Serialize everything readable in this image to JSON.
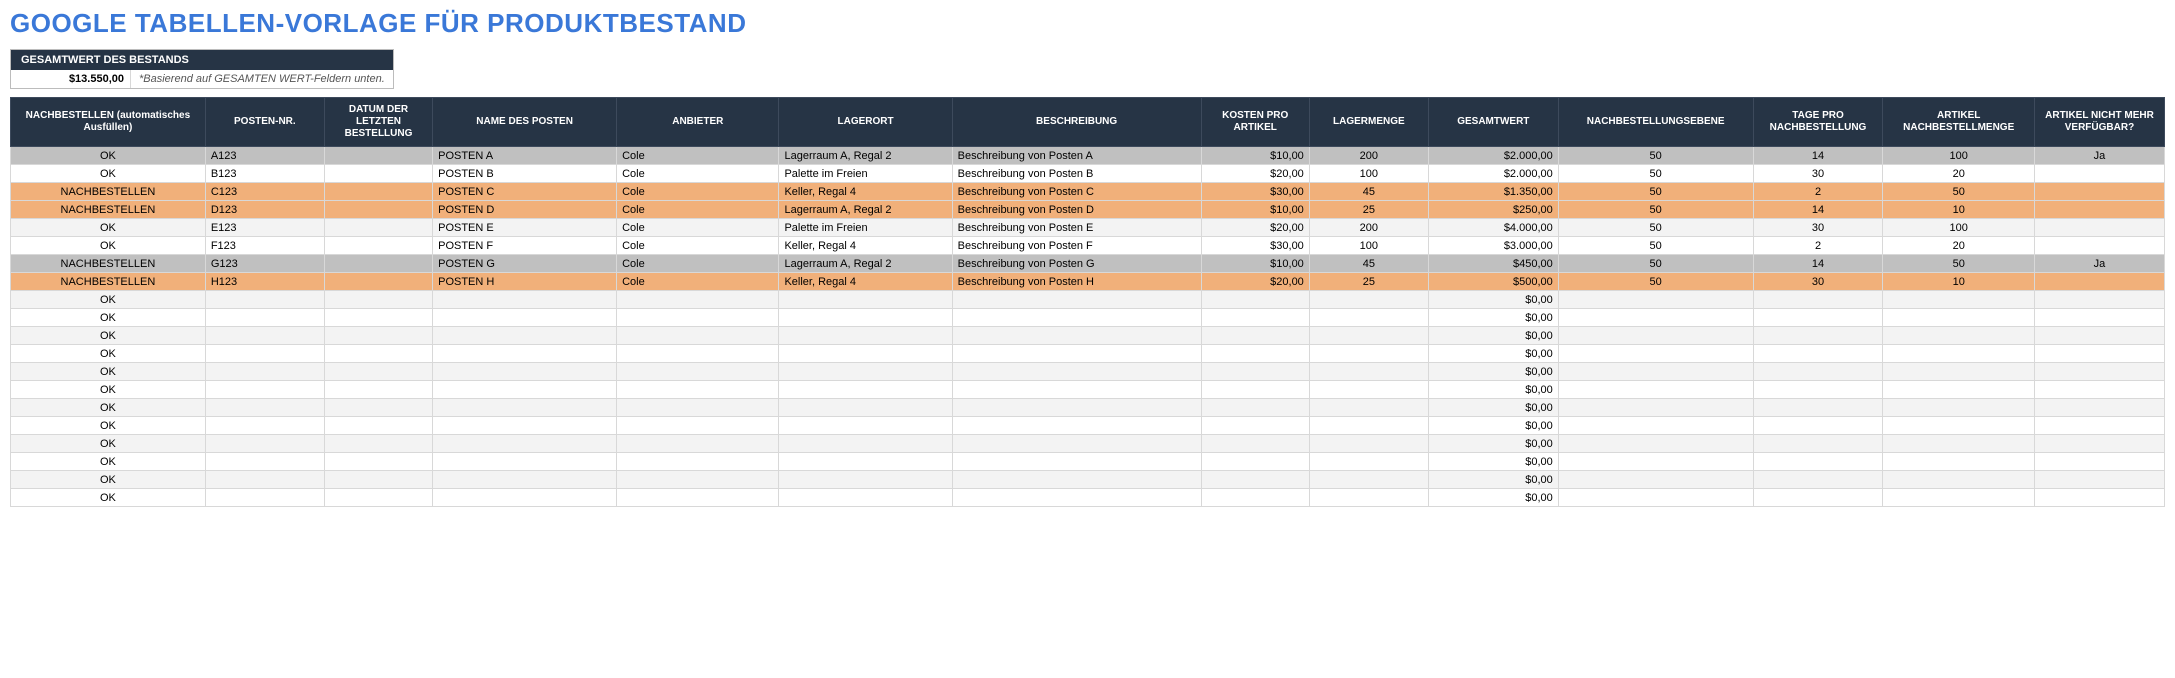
{
  "title": "GOOGLE TABELLEN-VORLAGE FÜR PRODUKTBESTAND",
  "summary": {
    "label": "GESAMTWERT DES BESTANDS",
    "value": "$13.550,00",
    "note": "*Basierend auf GESAMTEN WERT-Feldern unten."
  },
  "columns": [
    "NACHBESTELLEN (automatisches Ausfüllen)",
    "POSTEN-NR.",
    "DATUM DER LETZTEN BESTELLUNG",
    "NAME DES POSTEN",
    "ANBIETER",
    "LAGERORT",
    "BESCHREIBUNG",
    "KOSTEN PRO ARTIKEL",
    "LAGERMENGE",
    "GESAMTWERT",
    "NACHBESTELLUNGSEBENE",
    "TAGE PRO NACHBESTELLUNG",
    "ARTIKEL NACHBESTELLMENGE",
    "ARTIKEL NICHT MEHR VERFÜGBAR?"
  ],
  "rows": [
    {
      "style": "grey",
      "reorder": "OK",
      "item": "A123",
      "date": "",
      "name": "POSTEN A",
      "vendor": "Cole",
      "loc": "Lagerraum A, Regal 2",
      "desc": "Beschreibung von Posten A",
      "cost": "$10,00",
      "qty": "200",
      "total": "$2.000,00",
      "level": "50",
      "days": "14",
      "reqty": "100",
      "disc": "Ja"
    },
    {
      "style": "odd",
      "reorder": "OK",
      "item": "B123",
      "date": "",
      "name": "POSTEN B",
      "vendor": "Cole",
      "loc": "Palette im Freien",
      "desc": "Beschreibung von Posten B",
      "cost": "$20,00",
      "qty": "100",
      "total": "$2.000,00",
      "level": "50",
      "days": "30",
      "reqty": "20",
      "disc": ""
    },
    {
      "style": "orange",
      "reorder": "NACHBESTELLEN",
      "item": "C123",
      "date": "",
      "name": "POSTEN C",
      "vendor": "Cole",
      "loc": "Keller, Regal 4",
      "desc": "Beschreibung von Posten C",
      "cost": "$30,00",
      "qty": "45",
      "total": "$1.350,00",
      "level": "50",
      "days": "2",
      "reqty": "50",
      "disc": ""
    },
    {
      "style": "orange",
      "reorder": "NACHBESTELLEN",
      "item": "D123",
      "date": "",
      "name": "POSTEN D",
      "vendor": "Cole",
      "loc": "Lagerraum A, Regal 2",
      "desc": "Beschreibung von Posten D",
      "cost": "$10,00",
      "qty": "25",
      "total": "$250,00",
      "level": "50",
      "days": "14",
      "reqty": "10",
      "disc": ""
    },
    {
      "style": "even",
      "reorder": "OK",
      "item": "E123",
      "date": "",
      "name": "POSTEN E",
      "vendor": "Cole",
      "loc": "Palette im Freien",
      "desc": "Beschreibung von Posten E",
      "cost": "$20,00",
      "qty": "200",
      "total": "$4.000,00",
      "level": "50",
      "days": "30",
      "reqty": "100",
      "disc": ""
    },
    {
      "style": "odd",
      "reorder": "OK",
      "item": "F123",
      "date": "",
      "name": "POSTEN F",
      "vendor": "Cole",
      "loc": "Keller, Regal 4",
      "desc": "Beschreibung von Posten F",
      "cost": "$30,00",
      "qty": "100",
      "total": "$3.000,00",
      "level": "50",
      "days": "2",
      "reqty": "20",
      "disc": ""
    },
    {
      "style": "grey",
      "reorder": "NACHBESTELLEN",
      "item": "G123",
      "date": "",
      "name": "POSTEN G",
      "vendor": "Cole",
      "loc": "Lagerraum A, Regal 2",
      "desc": "Beschreibung von Posten G",
      "cost": "$10,00",
      "qty": "45",
      "total": "$450,00",
      "level": "50",
      "days": "14",
      "reqty": "50",
      "disc": "Ja"
    },
    {
      "style": "orange",
      "reorder": "NACHBESTELLEN",
      "item": "H123",
      "date": "",
      "name": "POSTEN H",
      "vendor": "Cole",
      "loc": "Keller, Regal 4",
      "desc": "Beschreibung von Posten H",
      "cost": "$20,00",
      "qty": "25",
      "total": "$500,00",
      "level": "50",
      "days": "30",
      "reqty": "10",
      "disc": ""
    },
    {
      "style": "even",
      "reorder": "OK",
      "item": "",
      "date": "",
      "name": "",
      "vendor": "",
      "loc": "",
      "desc": "",
      "cost": "",
      "qty": "",
      "total": "$0,00",
      "level": "",
      "days": "",
      "reqty": "",
      "disc": ""
    },
    {
      "style": "odd",
      "reorder": "OK",
      "item": "",
      "date": "",
      "name": "",
      "vendor": "",
      "loc": "",
      "desc": "",
      "cost": "",
      "qty": "",
      "total": "$0,00",
      "level": "",
      "days": "",
      "reqty": "",
      "disc": ""
    },
    {
      "style": "even",
      "reorder": "OK",
      "item": "",
      "date": "",
      "name": "",
      "vendor": "",
      "loc": "",
      "desc": "",
      "cost": "",
      "qty": "",
      "total": "$0,00",
      "level": "",
      "days": "",
      "reqty": "",
      "disc": ""
    },
    {
      "style": "odd",
      "reorder": "OK",
      "item": "",
      "date": "",
      "name": "",
      "vendor": "",
      "loc": "",
      "desc": "",
      "cost": "",
      "qty": "",
      "total": "$0,00",
      "level": "",
      "days": "",
      "reqty": "",
      "disc": ""
    },
    {
      "style": "even",
      "reorder": "OK",
      "item": "",
      "date": "",
      "name": "",
      "vendor": "",
      "loc": "",
      "desc": "",
      "cost": "",
      "qty": "",
      "total": "$0,00",
      "level": "",
      "days": "",
      "reqty": "",
      "disc": ""
    },
    {
      "style": "odd",
      "reorder": "OK",
      "item": "",
      "date": "",
      "name": "",
      "vendor": "",
      "loc": "",
      "desc": "",
      "cost": "",
      "qty": "",
      "total": "$0,00",
      "level": "",
      "days": "",
      "reqty": "",
      "disc": ""
    },
    {
      "style": "even",
      "reorder": "OK",
      "item": "",
      "date": "",
      "name": "",
      "vendor": "",
      "loc": "",
      "desc": "",
      "cost": "",
      "qty": "",
      "total": "$0,00",
      "level": "",
      "days": "",
      "reqty": "",
      "disc": ""
    },
    {
      "style": "odd",
      "reorder": "OK",
      "item": "",
      "date": "",
      "name": "",
      "vendor": "",
      "loc": "",
      "desc": "",
      "cost": "",
      "qty": "",
      "total": "$0,00",
      "level": "",
      "days": "",
      "reqty": "",
      "disc": ""
    },
    {
      "style": "even",
      "reorder": "OK",
      "item": "",
      "date": "",
      "name": "",
      "vendor": "",
      "loc": "",
      "desc": "",
      "cost": "",
      "qty": "",
      "total": "$0,00",
      "level": "",
      "days": "",
      "reqty": "",
      "disc": ""
    },
    {
      "style": "odd",
      "reorder": "OK",
      "item": "",
      "date": "",
      "name": "",
      "vendor": "",
      "loc": "",
      "desc": "",
      "cost": "",
      "qty": "",
      "total": "$0,00",
      "level": "",
      "days": "",
      "reqty": "",
      "disc": ""
    },
    {
      "style": "even",
      "reorder": "OK",
      "item": "",
      "date": "",
      "name": "",
      "vendor": "",
      "loc": "",
      "desc": "",
      "cost": "",
      "qty": "",
      "total": "$0,00",
      "level": "",
      "days": "",
      "reqty": "",
      "disc": ""
    },
    {
      "style": "odd",
      "reorder": "OK",
      "item": "",
      "date": "",
      "name": "",
      "vendor": "",
      "loc": "",
      "desc": "",
      "cost": "",
      "qty": "",
      "total": "$0,00",
      "level": "",
      "days": "",
      "reqty": "",
      "disc": ""
    }
  ]
}
